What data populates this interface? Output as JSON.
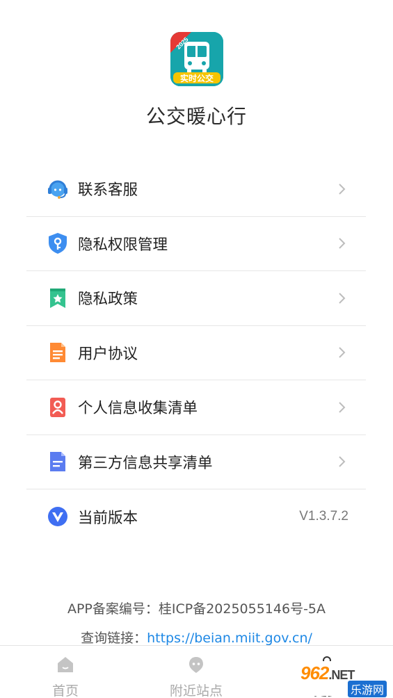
{
  "app": {
    "name": "公交暖心行",
    "logo_badge": "2025",
    "logo_caption": "实时公交"
  },
  "menu": {
    "items": [
      {
        "label": "联系客服",
        "icon": "headset-icon"
      },
      {
        "label": "隐私权限管理",
        "icon": "shield-key-icon"
      },
      {
        "label": "隐私政策",
        "icon": "bookmark-star-icon"
      },
      {
        "label": "用户协议",
        "icon": "document-icon"
      },
      {
        "label": "个人信息收集清单",
        "icon": "person-card-icon"
      },
      {
        "label": "第三方信息共享清单",
        "icon": "file-lines-icon"
      },
      {
        "label": "当前版本",
        "icon": "v-logo-icon",
        "value": "V1.3.7.2"
      }
    ]
  },
  "footer": {
    "icp": "APP备案编号：桂ICP备2025055146号-5A",
    "query_label": "查询链接：",
    "query_link": "https://beian.miit.gov.cn/"
  },
  "tabbar": {
    "tabs": [
      {
        "label": "首页",
        "icon": "home-icon"
      },
      {
        "label": "附近站点",
        "icon": "location-icon"
      },
      {
        "label": "更多",
        "icon": "more-icon"
      }
    ]
  },
  "watermark": {
    "top": "962",
    "net": ".NET",
    "bottom": "乐游网"
  },
  "colors": {
    "accent": "#1e88e5",
    "logo_teal": "#16a2a8",
    "logo_yellow": "#f5c400",
    "badge_red": "#e53935"
  }
}
